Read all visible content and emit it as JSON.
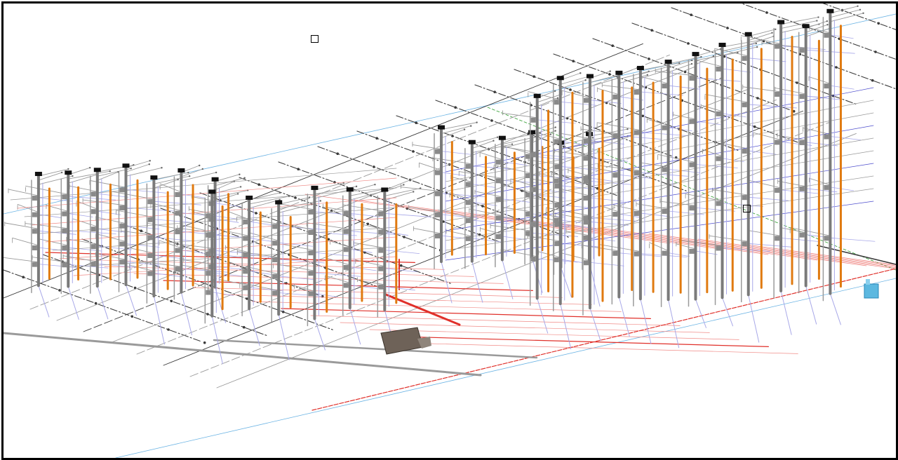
{
  "view": {
    "title": "",
    "colors": {
      "pipe_default": "#3a3a3a",
      "pipe_light": "#9a9a9a",
      "pipe_hot": "#e0302a",
      "pipe_hot_light": "#f08a86",
      "pipe_cold": "#4a4acc",
      "pipe_cold_light": "#a8a8e8",
      "riser_orange": "#e07a10",
      "riser_grey": "#7a7a7a",
      "gridline_blue": "#6cb4e4",
      "gridline_green": "#2a9a2a",
      "equipment_brown": "#6e6258",
      "tank_blue": "#5cb8e0",
      "border": "#000000"
    },
    "icons": [
      "view-cube-icon",
      "selection-box-icon"
    ],
    "elements": {
      "riser_groups": 4,
      "equipment": [
        "tank",
        "pump-skid"
      ]
    }
  }
}
